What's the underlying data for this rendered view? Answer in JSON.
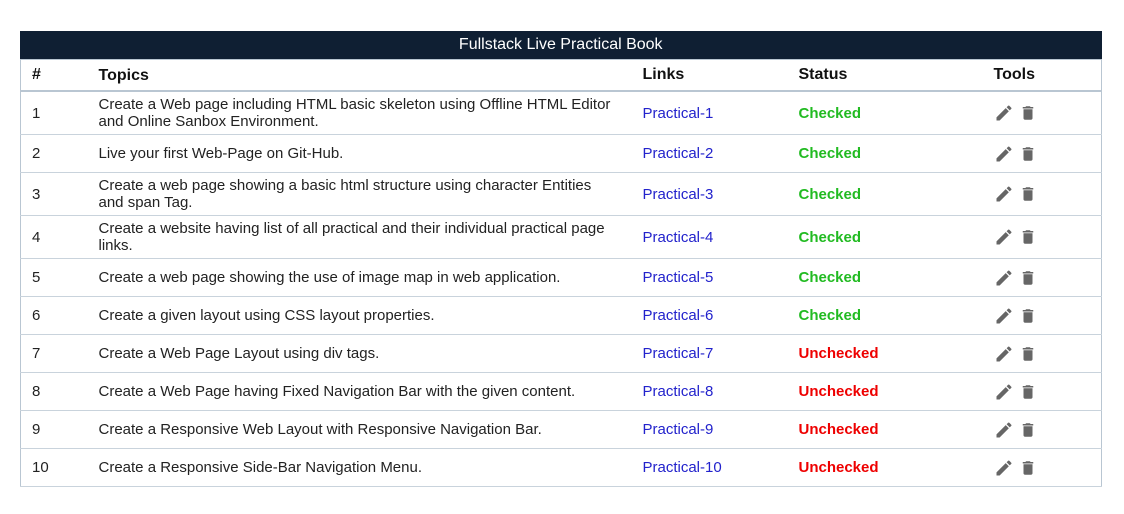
{
  "table": {
    "title": "Fullstack Live Practical Book",
    "headers": {
      "num": "#",
      "topic": "Topics",
      "link": "Links",
      "status": "Status",
      "tools": "Tools"
    },
    "rows": [
      {
        "num": "1",
        "topic": "Create a Web page including HTML basic skeleton using Offline HTML Editor and Online Sanbox Environment.",
        "link": "Practical-1",
        "status": "Checked"
      },
      {
        "num": "2",
        "topic": "Live your first Web-Page on Git-Hub.",
        "link": "Practical-2",
        "status": "Checked"
      },
      {
        "num": "3",
        "topic": "Create a web page showing a basic html structure using character Entities and span Tag.",
        "link": "Practical-3",
        "status": "Checked"
      },
      {
        "num": "4",
        "topic": "Create a website having list of all practical and their individual practical page links.",
        "link": "Practical-4",
        "status": "Checked"
      },
      {
        "num": "5",
        "topic": "Create a web page showing the use of image map in web application.",
        "link": "Practical-5",
        "status": "Checked"
      },
      {
        "num": "6",
        "topic": "Create a given layout using CSS layout properties.",
        "link": "Practical-6",
        "status": "Checked"
      },
      {
        "num": "7",
        "topic": "Create a Web Page Layout using div tags.",
        "link": "Practical-7",
        "status": "Unchecked"
      },
      {
        "num": "8",
        "topic": "Create a Web Page having Fixed Navigation Bar with the given content.",
        "link": "Practical-8",
        "status": "Unchecked"
      },
      {
        "num": "9",
        "topic": "Create a Responsive Web Layout with Responsive Navigation Bar.",
        "link": "Practical-9",
        "status": "Unchecked"
      },
      {
        "num": "10",
        "topic": "Create a Responsive Side-Bar Navigation Menu.",
        "link": "Practical-10",
        "status": "Unchecked"
      }
    ]
  },
  "icons": {
    "edit": "pencil-icon",
    "delete": "trash-icon"
  },
  "colors": {
    "header_bg": "#0f1f33",
    "link": "#2222cc",
    "checked": "#22bb22",
    "unchecked": "#ee0000",
    "icon": "#666666"
  }
}
